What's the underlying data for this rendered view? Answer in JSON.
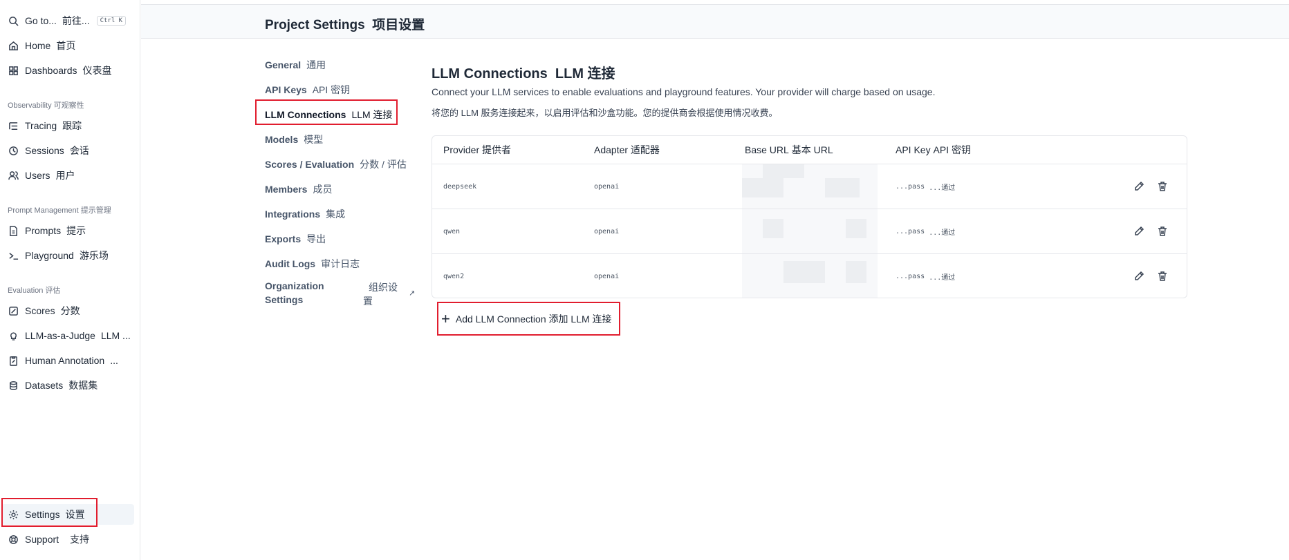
{
  "sidebar": {
    "goto": {
      "label": "Go to...",
      "zh": "前往...",
      "shortcut": "Ctrl K"
    },
    "home": {
      "label": "Home",
      "zh": "首页"
    },
    "dashboards": {
      "label": "Dashboards",
      "zh": "仪表盘"
    },
    "observability": {
      "label": "Observability",
      "zh": "可观察性"
    },
    "tracing": {
      "label": "Tracing",
      "zh": "跟踪"
    },
    "sessions": {
      "label": "Sessions",
      "zh": "会话"
    },
    "users": {
      "label": "Users",
      "zh": "用户"
    },
    "prompt_management": {
      "label": "Prompt Management",
      "zh": "提示管理"
    },
    "prompts": {
      "label": "Prompts",
      "zh": "提示"
    },
    "playground": {
      "label": "Playground",
      "zh": "游乐场"
    },
    "evaluation": {
      "label": "Evaluation",
      "zh": "评估"
    },
    "scores": {
      "label": "Scores",
      "zh": "分数"
    },
    "llm_judge": {
      "label": "LLM-as-a-Judge",
      "zh": "LLM ..."
    },
    "human_annotation": {
      "label": "Human Annotation",
      "zh": "..."
    },
    "datasets": {
      "label": "Datasets",
      "zh": "数据集"
    },
    "settings": {
      "label": "Settings",
      "zh": "设置"
    },
    "support": {
      "label": "Support",
      "zh": "支持"
    }
  },
  "header": {
    "title": "Project Settings",
    "title_zh": "项目设置"
  },
  "settings_nav": {
    "general": {
      "label": "General",
      "zh": "通用"
    },
    "api_keys": {
      "label": "API Keys",
      "zh": "API 密钥"
    },
    "llm_connections": {
      "label": "LLM Connections",
      "zh": "LLM 连接"
    },
    "models": {
      "label": "Models",
      "zh": "模型"
    },
    "scores": {
      "label": "Scores / Evaluation",
      "zh": "分数 / 评估"
    },
    "members": {
      "label": "Members",
      "zh": "成员"
    },
    "integrations": {
      "label": "Integrations",
      "zh": "集成"
    },
    "exports": {
      "label": "Exports",
      "zh": "导出"
    },
    "audit_logs": {
      "label": "Audit Logs",
      "zh": "审计日志"
    },
    "organization": {
      "line1": "Organization",
      "line2": "Settings",
      "zh1": "组织设",
      "zh2": "置",
      "ext": "↗"
    }
  },
  "main": {
    "title": "LLM Connections",
    "title_zh": "LLM 连接",
    "description": "Connect your LLM services to enable evaluations and playground features. Your provider will charge based on usage.",
    "description_zh": "将您的 LLM 服务连接起来，以启用评估和沙盒功能。您的提供商会根据使用情况收费。",
    "table": {
      "headers": [
        {
          "label": "Provider",
          "zh": "提供者"
        },
        {
          "label": "Adapter",
          "zh": "适配器"
        },
        {
          "label": "Base URL",
          "zh": "基本 URL"
        },
        {
          "label": "API Key",
          "zh": "API 密钥"
        }
      ],
      "rows": [
        {
          "provider": "deepseek",
          "adapter": "openai",
          "api_key": "...pass",
          "api_key_zh": "...通过"
        },
        {
          "provider": "qwen",
          "adapter": "openai",
          "api_key": "...pass",
          "api_key_zh": "...通过"
        },
        {
          "provider": "qwen2",
          "adapter": "openai",
          "api_key": "...pass",
          "api_key_zh": "...通过"
        }
      ]
    },
    "add_button": {
      "label": "Add LLM Connection",
      "zh": "添加 LLM 连接"
    }
  },
  "colors": {
    "highlight": "#e11d2e",
    "header_bg": "#f8fafc",
    "active_bg": "#f1f5f9"
  }
}
